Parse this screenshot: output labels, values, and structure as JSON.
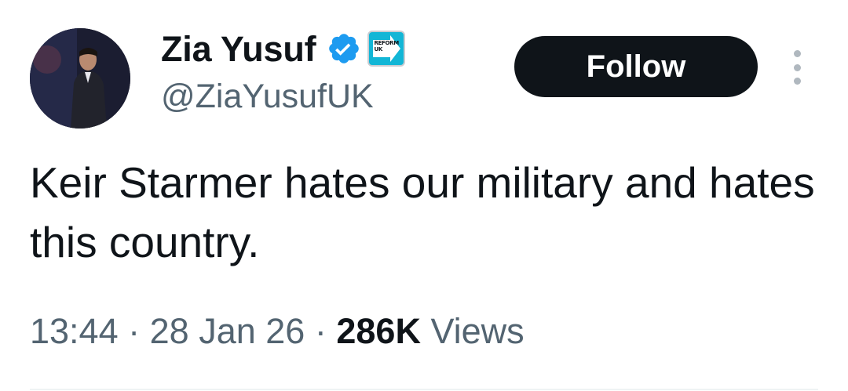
{
  "author": {
    "display_name": "Zia Yusuf",
    "handle": "@ZiaYusufUK",
    "verified_icon": "verified-badge-icon",
    "affiliate_badge_text_1": "REFORM",
    "affiliate_badge_text_2": "UK"
  },
  "follow_button_label": "Follow",
  "more_icon": "more-options-icon",
  "tweet": {
    "text": "Keir Starmer hates our military and hates this country.",
    "time": "13:44",
    "separator": "·",
    "date": "28 Jan 26",
    "views_count": "286K",
    "views_label": "Views"
  },
  "colors": {
    "verified_blue": "#1d9bf0",
    "text_primary": "#0f1419",
    "text_secondary": "#536471",
    "follow_bg": "#0f1419",
    "badge_teal": "#12b6d6"
  }
}
